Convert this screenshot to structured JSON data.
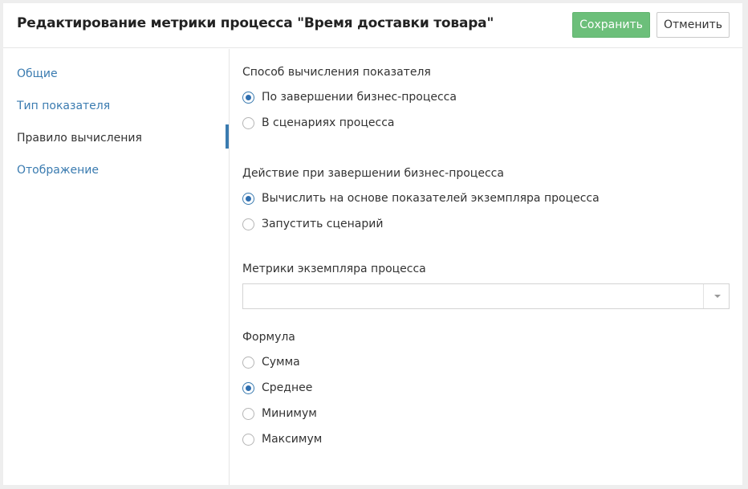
{
  "header": {
    "title": "Редактирование метрики процесса \"Время доставки товара\"",
    "save_label": "Сохранить",
    "cancel_label": "Отменить",
    "save_color": "#6cbf7a"
  },
  "sidebar": {
    "items": [
      {
        "label": "Общие",
        "active": false
      },
      {
        "label": "Тип показателя",
        "active": false
      },
      {
        "label": "Правило вычисления",
        "active": true
      },
      {
        "label": "Отображение",
        "active": false
      }
    ],
    "accent_color": "#3a7bb0"
  },
  "calc_method": {
    "label": "Способ вычисления показателя",
    "options": [
      {
        "label": "По завершении бизнес-процесса",
        "checked": true
      },
      {
        "label": "В сценариях процесса",
        "checked": false
      }
    ]
  },
  "completion_action": {
    "label": "Действие при завершении бизнес-процесса",
    "options": [
      {
        "label": "Вычислить на основе показателей экземпляра процесса",
        "checked": true
      },
      {
        "label": "Запустить сценарий",
        "checked": false
      }
    ]
  },
  "instance_metrics": {
    "label": "Метрики экземпляра процесса",
    "value": "",
    "icon": "chevron-down-icon"
  },
  "formula": {
    "label": "Формула",
    "options": [
      {
        "label": "Сумма",
        "checked": false
      },
      {
        "label": "Среднее",
        "checked": true
      },
      {
        "label": "Минимум",
        "checked": false
      },
      {
        "label": "Максимум",
        "checked": false
      }
    ]
  }
}
